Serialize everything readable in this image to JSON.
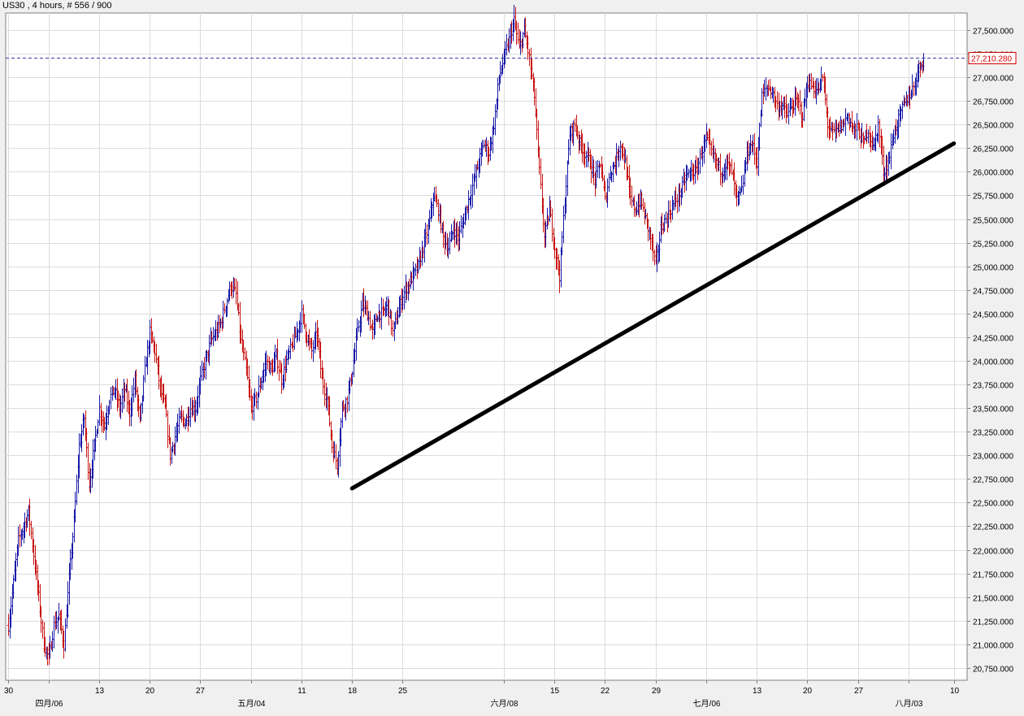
{
  "chart": {
    "title": "US30 , 4 hours, # 556 / 900"
  },
  "chart_data": {
    "type": "ohlc",
    "symbol": "US30",
    "timeframe": "4 hours",
    "ylim": [
      20620,
      27680
    ],
    "xlim": [
      0,
      188
    ],
    "y_ticks": [
      "27,500.000",
      "27,250.000",
      "27,000.000",
      "26,750.000",
      "26,500.000",
      "26,250.000",
      "26,000.000",
      "25,750.000",
      "25,500.000",
      "25,250.000",
      "25,000.000",
      "24,750.000",
      "24,500.000",
      "24,250.000",
      "24,000.000",
      "23,750.000",
      "23,500.000",
      "23,250.000",
      "23,000.000",
      "22,750.000",
      "22,500.000",
      "22,250.000",
      "22,000.000",
      "21,750.000",
      "21,500.000",
      "21,250.000",
      "21,000.000",
      "20,750.000"
    ],
    "x_ticks": [
      {
        "idx": 0,
        "label": "30",
        "row": 1
      },
      {
        "idx": 8,
        "label": "四月/06",
        "row": 2
      },
      {
        "idx": 18,
        "label": "13",
        "row": 1
      },
      {
        "idx": 28,
        "label": "20",
        "row": 1
      },
      {
        "idx": 38,
        "label": "27",
        "row": 1
      },
      {
        "idx": 48,
        "label": "五月/04",
        "row": 2
      },
      {
        "idx": 58,
        "label": "11",
        "row": 1
      },
      {
        "idx": 68,
        "label": "18",
        "row": 1
      },
      {
        "idx": 78,
        "label": "25",
        "row": 1
      },
      {
        "idx": 98,
        "label": "六月/08",
        "row": 2
      },
      {
        "idx": 108,
        "label": "15",
        "row": 1
      },
      {
        "idx": 118,
        "label": "22",
        "row": 1
      },
      {
        "idx": 128,
        "label": "29",
        "row": 1
      },
      {
        "idx": 138,
        "label": "七月/06",
        "row": 2
      },
      {
        "idx": 148,
        "label": "13",
        "row": 1
      },
      {
        "idx": 158,
        "label": "20",
        "row": 1
      },
      {
        "idx": 168,
        "label": "27",
        "row": 1
      },
      {
        "idx": 178,
        "label": "八月/03",
        "row": 2
      },
      {
        "idx": 187,
        "label": "10",
        "row": 1
      }
    ],
    "current_price": 27210.28,
    "current_price_label": "27,210.280",
    "price_path": [
      [
        0,
        21200
      ],
      [
        2,
        22100
      ],
      [
        4,
        22400
      ],
      [
        6,
        21500
      ],
      [
        7,
        21000
      ],
      [
        8,
        20850
      ],
      [
        9,
        21200
      ],
      [
        10,
        21300
      ],
      [
        11,
        21000
      ],
      [
        12,
        21700
      ],
      [
        13,
        22300
      ],
      [
        14,
        23100
      ],
      [
        15,
        23400
      ],
      [
        16,
        22700
      ],
      [
        17,
        23100
      ],
      [
        18,
        23500
      ],
      [
        19,
        23300
      ],
      [
        20,
        23600
      ],
      [
        21,
        23700
      ],
      [
        22,
        23500
      ],
      [
        23,
        23700
      ],
      [
        24,
        23450
      ],
      [
        25,
        23800
      ],
      [
        26,
        23350
      ],
      [
        27,
        23900
      ],
      [
        28,
        24300
      ],
      [
        29,
        24100
      ],
      [
        30,
        23700
      ],
      [
        31,
        23500
      ],
      [
        32,
        23000
      ],
      [
        33,
        23200
      ],
      [
        34,
        23400
      ],
      [
        35,
        23350
      ],
      [
        36,
        23500
      ],
      [
        37,
        23500
      ],
      [
        38,
        23800
      ],
      [
        39,
        24000
      ],
      [
        40,
        24200
      ],
      [
        41,
        24300
      ],
      [
        42,
        24400
      ],
      [
        43,
        24600
      ],
      [
        44,
        24800
      ],
      [
        45,
        24700
      ],
      [
        46,
        24200
      ],
      [
        47,
        23900
      ],
      [
        48,
        23500
      ],
      [
        49,
        23600
      ],
      [
        50,
        23800
      ],
      [
        51,
        24000
      ],
      [
        52,
        23900
      ],
      [
        53,
        24050
      ],
      [
        54,
        23800
      ],
      [
        55,
        24000
      ],
      [
        56,
        24150
      ],
      [
        57,
        24300
      ],
      [
        58,
        24500
      ],
      [
        59,
        24250
      ],
      [
        60,
        24100
      ],
      [
        61,
        24300
      ],
      [
        62,
        23800
      ],
      [
        63,
        23600
      ],
      [
        64,
        23100
      ],
      [
        65,
        22900
      ],
      [
        66,
        23500
      ],
      [
        67,
        23600
      ],
      [
        68,
        23900
      ],
      [
        69,
        24300
      ],
      [
        70,
        24600
      ],
      [
        71,
        24500
      ],
      [
        72,
        24300
      ],
      [
        73,
        24500
      ],
      [
        74,
        24500
      ],
      [
        75,
        24600
      ],
      [
        76,
        24300
      ],
      [
        77,
        24500
      ],
      [
        78,
        24700
      ],
      [
        79,
        24800
      ],
      [
        80,
        24900
      ],
      [
        81,
        25000
      ],
      [
        82,
        25200
      ],
      [
        83,
        25400
      ],
      [
        84,
        25750
      ],
      [
        85,
        25600
      ],
      [
        86,
        25300
      ],
      [
        87,
        25200
      ],
      [
        88,
        25400
      ],
      [
        89,
        25300
      ],
      [
        90,
        25500
      ],
      [
        91,
        25700
      ],
      [
        92,
        25900
      ],
      [
        93,
        26100
      ],
      [
        94,
        26300
      ],
      [
        95,
        26200
      ],
      [
        96,
        26500
      ],
      [
        97,
        27000
      ],
      [
        98,
        27200
      ],
      [
        99,
        27400
      ],
      [
        100,
        27600
      ],
      [
        101,
        27300
      ],
      [
        102,
        27500
      ],
      [
        103,
        27200
      ],
      [
        104,
        26800
      ],
      [
        105,
        26000
      ],
      [
        106,
        25300
      ],
      [
        107,
        25600
      ],
      [
        108,
        25200
      ],
      [
        109,
        24900
      ],
      [
        110,
        25700
      ],
      [
        111,
        26400
      ],
      [
        112,
        26500
      ],
      [
        113,
        26300
      ],
      [
        114,
        26200
      ],
      [
        115,
        26100
      ],
      [
        116,
        25900
      ],
      [
        117,
        26100
      ],
      [
        118,
        25700
      ],
      [
        119,
        26000
      ],
      [
        120,
        26100
      ],
      [
        121,
        26300
      ],
      [
        122,
        26100
      ],
      [
        123,
        25700
      ],
      [
        124,
        25600
      ],
      [
        125,
        25700
      ],
      [
        126,
        25500
      ],
      [
        127,
        25300
      ],
      [
        128,
        25000
      ],
      [
        129,
        25400
      ],
      [
        130,
        25500
      ],
      [
        131,
        25600
      ],
      [
        132,
        25700
      ],
      [
        133,
        25800
      ],
      [
        134,
        25950
      ],
      [
        135,
        26000
      ],
      [
        136,
        26000
      ],
      [
        137,
        26200
      ],
      [
        138,
        26350
      ],
      [
        139,
        26200
      ],
      [
        140,
        26100
      ],
      [
        141,
        26000
      ],
      [
        142,
        26100
      ],
      [
        143,
        26000
      ],
      [
        144,
        25700
      ],
      [
        145,
        25800
      ],
      [
        146,
        26200
      ],
      [
        147,
        26300
      ],
      [
        148,
        26100
      ],
      [
        149,
        26800
      ],
      [
        150,
        26900
      ],
      [
        151,
        26850
      ],
      [
        152,
        26700
      ],
      [
        153,
        26700
      ],
      [
        154,
        26600
      ],
      [
        155,
        26700
      ],
      [
        156,
        26750
      ],
      [
        157,
        26600
      ],
      [
        158,
        26950
      ],
      [
        159,
        26900
      ],
      [
        160,
        26850
      ],
      [
        161,
        27000
      ],
      [
        162,
        26500
      ],
      [
        163,
        26400
      ],
      [
        164,
        26450
      ],
      [
        165,
        26500
      ],
      [
        166,
        26600
      ],
      [
        167,
        26450
      ],
      [
        168,
        26450
      ],
      [
        169,
        26300
      ],
      [
        170,
        26450
      ],
      [
        171,
        26250
      ],
      [
        172,
        26500
      ],
      [
        173,
        26000
      ],
      [
        174,
        26100
      ],
      [
        175,
        26400
      ],
      [
        176,
        26550
      ],
      [
        177,
        26700
      ],
      [
        178,
        26800
      ],
      [
        179,
        26900
      ],
      [
        180,
        27100
      ],
      [
        181,
        27200
      ]
    ],
    "trendline": [
      [
        68,
        22650
      ],
      [
        187,
        26300
      ]
    ],
    "grid": true
  }
}
